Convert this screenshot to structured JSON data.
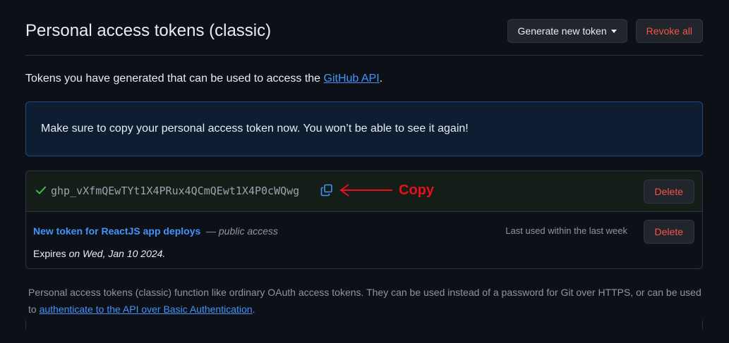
{
  "header": {
    "title": "Personal access tokens (classic)",
    "generate_label": "Generate new token",
    "revoke_label": "Revoke all"
  },
  "intro": {
    "text": "Tokens you have generated that can be used to access the ",
    "link": "GitHub API",
    "suffix": "."
  },
  "flash": {
    "message": "Make sure to copy your personal access token now. You won’t be able to see it again!"
  },
  "new_token": {
    "value": "ghp_vXfmQEwTYt1X4PRux4QCmQEwt1X4P0cWQwg",
    "annotation": "Copy",
    "delete_label": "Delete"
  },
  "token": {
    "name": "New token for ReactJS app deploys",
    "separator": " — ",
    "scope": "public access",
    "last_used": "Last used within the last week",
    "expires_label": "Expires ",
    "expires_on": "on Wed, Jan 10 2024.",
    "delete_label": "Delete"
  },
  "footer": {
    "text": "Personal access tokens (classic) function like ordinary OAuth access tokens. They can be used instead of a password for Git over HTTPS, or can be used to ",
    "link": "authenticate to the API over Basic Authentication",
    "suffix": "."
  },
  "colors": {
    "background": "#0d1117",
    "link": "#4493f8",
    "danger": "#f85149",
    "success": "#3fb950",
    "annotation": "#e8101a"
  },
  "icons": {
    "check": "check-icon",
    "copy": "copy-icon",
    "caret": "caret-down-icon",
    "arrow": "arrow-left-icon"
  }
}
